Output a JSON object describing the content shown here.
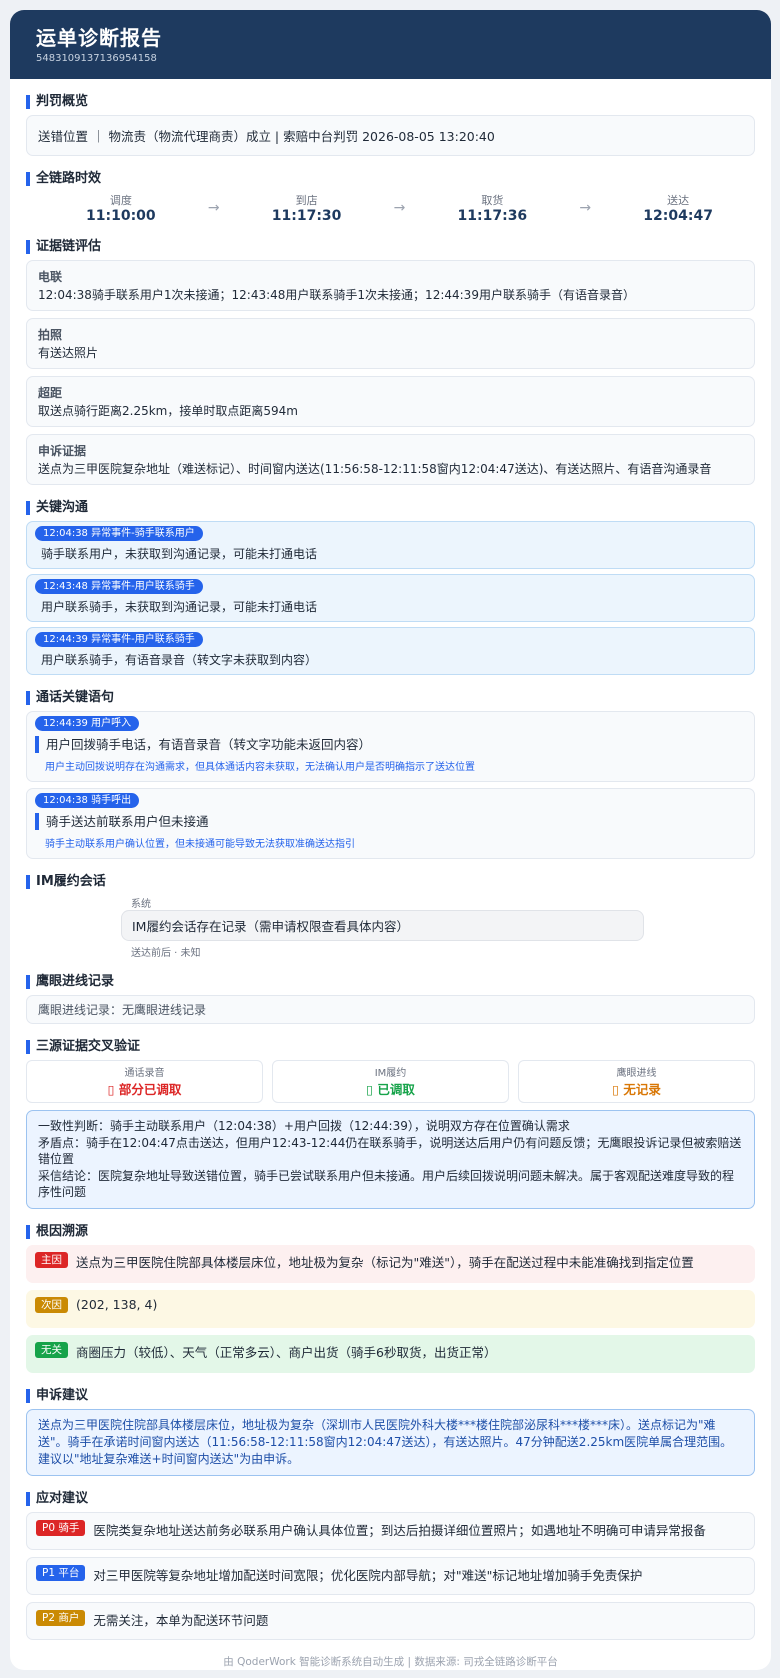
{
  "header": {
    "title": "运单诊断报告",
    "order_id": "5483109137136954158"
  },
  "penalty": {
    "section_title": "判罚概览",
    "text": "送错位置 ｜ 物流责（物流代理商责）成立 | 索赔中台判罚 2026-08-05 13:20:40"
  },
  "timeline": {
    "section_title": "全链路时效",
    "nodes": [
      {
        "label": "调度",
        "time": "11:10:00"
      },
      {
        "label": "到店",
        "time": "11:17:30"
      },
      {
        "label": "取货",
        "time": "11:17:36"
      },
      {
        "label": "送达",
        "time": "12:04:47"
      }
    ],
    "arrow": "→"
  },
  "evidence": {
    "section_title": "证据链评估",
    "items": [
      {
        "label": "电联",
        "text": "12:04:38骑手联系用户1次未接通；12:43:48用户联系骑手1次未接通；12:44:39用户联系骑手（有语音录音）"
      },
      {
        "label": "拍照",
        "text": "有送达照片"
      },
      {
        "label": "超距",
        "text": "取送点骑行距离2.25km，接单时取点距离594m"
      },
      {
        "label": "申诉证据",
        "text": "送点为三甲医院复杂地址（难送标记）、时间窗内送达(11:56:58-12:11:58窗内12:04:47送达)、有送达照片、有语音沟通录音"
      }
    ]
  },
  "comm": {
    "section_title": "关键沟通",
    "items": [
      {
        "tag": "12:04:38  异常事件-骑手联系用户",
        "text": "骑手联系用户，未获取到沟通记录，可能未打通电话"
      },
      {
        "tag": "12:43:48  异常事件-用户联系骑手",
        "text": "用户联系骑手，未获取到沟通记录，可能未打通电话"
      },
      {
        "tag": "12:44:39  异常事件-用户联系骑手",
        "text": "用户联系骑手，有语音录音（转文字未获取到内容）"
      }
    ]
  },
  "calls": {
    "section_title": "通话关键语句",
    "items": [
      {
        "tag": "12:44:39  用户呼入",
        "text": "用户回拨骑手电话，有语音录音（转文字功能未返回内容）",
        "note": "用户主动回拨说明存在沟通需求，但具体通话内容未获取，无法确认用户是否明确指示了送达位置"
      },
      {
        "tag": "12:04:38  骑手呼出",
        "text": "骑手送达前联系用户但未接通",
        "note": "骑手主动联系用户确认位置，但未接通可能导致无法获取准确送达指引"
      }
    ]
  },
  "im": {
    "section_title": "IM履约会话",
    "sender": "系统",
    "message": "IM履约会话存在记录（需申请权限查看具体内容）",
    "meta": "送达前后 · 未知"
  },
  "hawk": {
    "section_title": "鹰眼进线记录",
    "text": "鹰眼进线记录：无鹰眼进线记录"
  },
  "cross": {
    "section_title": "三源证据交叉验证",
    "cells": [
      {
        "label": "通话录音",
        "value": "▯ 部分已调取",
        "color": "#dc2626"
      },
      {
        "label": "IM履约",
        "value": "▯ 已调取",
        "color": "#16a34a"
      },
      {
        "label": "鹰眼进线",
        "value": "▯ 无记录",
        "color": "#d97706"
      }
    ],
    "lines": [
      "一致性判断：骑手主动联系用户（12:04:38）+用户回拨（12:44:39），说明双方存在位置确认需求",
      "矛盾点：骑手在12:04:47点击送达，但用户12:43-12:44仍在联系骑手，说明送达后用户仍有问题反馈；无鹰眼投诉记录但被索赔送错位置",
      "采信结论：医院复杂地址导致送错位置，骑手已尝试联系用户但未接通。用户后续回拨说明问题未解决。属于客观配送难度导致的程序性问题"
    ]
  },
  "root": {
    "section_title": "根因溯源",
    "items": [
      {
        "tag": "主因",
        "tag_color": "#dc2626",
        "bg": "#fdf0f0",
        "text": "送点为三甲医院住院部具体楼层床位，地址极为复杂（标记为\"难送\"），骑手在配送过程中未能准确找到指定位置"
      },
      {
        "tag": "次因",
        "tag_color": "#ca8a04",
        "bg": "#fdf8e4",
        "text": "(202, 138, 4)"
      },
      {
        "tag": "无关",
        "tag_color": "#16a34a",
        "bg": "#e3f7e8",
        "text": "商圈压力（较低）、天气（正常多云）、商户出货（骑手6秒取货，出货正常）"
      }
    ]
  },
  "appeal": {
    "section_title": "申诉建议",
    "text": "送点为三甲医院住院部具体楼层床位，地址极为复杂（深圳市人民医院外科大楼***楼住院部泌尿科***楼***床）。送点标记为\"难送\"。骑手在承诺时间窗内送达（11:56:58-12:11:58窗内12:04:47送达），有送达照片。47分钟配送2.25km医院单属合理范围。建议以\"地址复杂难送+时间窗内送达\"为由申诉。"
  },
  "actions": {
    "section_title": "应对建议",
    "items": [
      {
        "tag": "P0 骑手",
        "tag_color": "#dc2626",
        "text": "医院类复杂地址送达前务必联系用户确认具体位置；到达后拍摄详细位置照片；如遇地址不明确可申请异常报备"
      },
      {
        "tag": "P1 平台",
        "tag_color": "#2563eb",
        "text": "对三甲医院等复杂地址增加配送时间宽限；优化医院内部导航；对\"难送\"标记地址增加骑手免责保护"
      },
      {
        "tag": "P2 商户",
        "tag_color": "#ca8a04",
        "text": "无需关注，本单为配送环节问题"
      }
    ]
  },
  "footer": "由 QoderWork 智能诊断系统自动生成 | 数据来源: 司戎全链路诊断平台"
}
